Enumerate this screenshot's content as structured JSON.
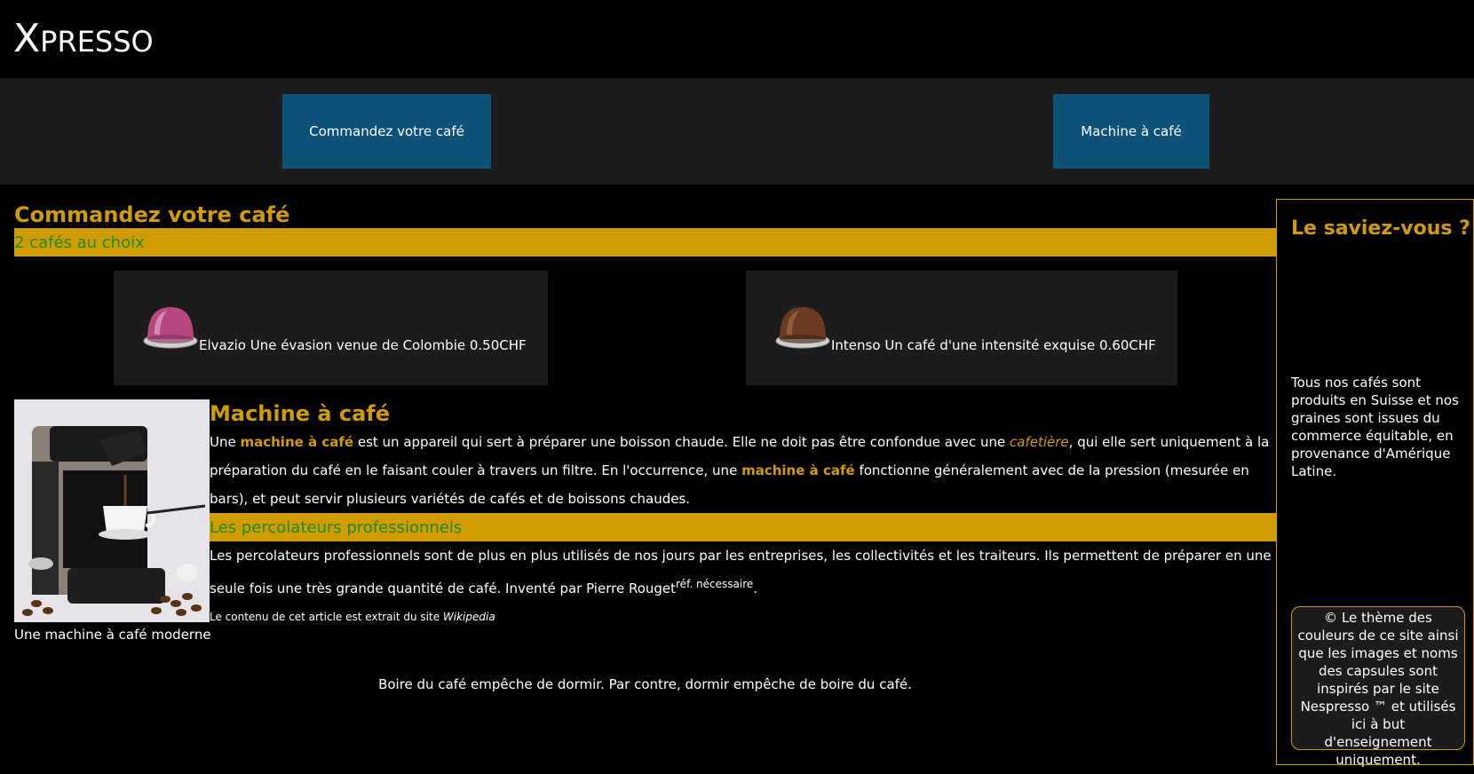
{
  "header": {
    "logo_first": "X",
    "logo_rest": "PRESSO"
  },
  "nav": {
    "items": [
      {
        "label": "Commandez votre café"
      },
      {
        "label": "Machine à café"
      }
    ]
  },
  "order": {
    "title": "Commandez votre café",
    "subtitle": "2 cafés au choix",
    "products": [
      {
        "name": "Elvazio",
        "desc": "Une évasion venue de Colombie",
        "price": "0.50CHF",
        "capsule_color": "#b5487f"
      },
      {
        "name": "Intenso",
        "desc": "Un café d'une intensité exquise",
        "price": "0.60CHF",
        "capsule_color": "#6b3a22"
      }
    ]
  },
  "article": {
    "image_caption": "Une machine à café moderne",
    "title": "Machine à café",
    "p1": {
      "t1": "Une ",
      "k1": "machine à café",
      "t2": " est un appareil qui sert à préparer une boisson chaude. Elle ne doit pas être confondue avec une ",
      "k2": "cafetière",
      "t3": ", qui elle sert uniquement à la préparation du café en le faisant couler à travers un filtre. En l'occurrence, une ",
      "k3": "machine à café",
      "t4": " fonctionne généralement avec de la pression (mesurée en bars), et peut servir plusieurs variétés de cafés et de boissons chaudes."
    },
    "subtitle": "Les percolateurs professionnels",
    "p2": {
      "text": "Les percolateurs professionnels sont de plus en plus utilisés de nos jours par les entreprises, les collectivités et les traiteurs. Ils permettent de préparer en une seule fois une très grande quantité de café. Inventé par Pierre Rouget",
      "sup": "réf. nécessaire",
      "end": "."
    },
    "source_text": "Le contenu de cet article est extrait du site ",
    "source_name": "Wikipedia"
  },
  "quote": "Boire du café empêche de dormir. Par contre, dormir empêche de boire du café.",
  "aside": {
    "title": "Le saviez-vous ?",
    "text": "Tous nos cafés sont produits en Suisse et nos graines sont issues du commerce équitable, en provenance d'Amérique Latine.",
    "copyright": "© Le thème des couleurs de ce site ainsi que les images et noms des capsules sont inspirés par le site Nespresso ™ et utilisés ici à but d'enseignement uniquement."
  },
  "colors": {
    "accent": "#d19c00",
    "nav_button": "#0e5279",
    "subtitle_green": "#1d8a1f",
    "panel": "#1c1c1c"
  }
}
